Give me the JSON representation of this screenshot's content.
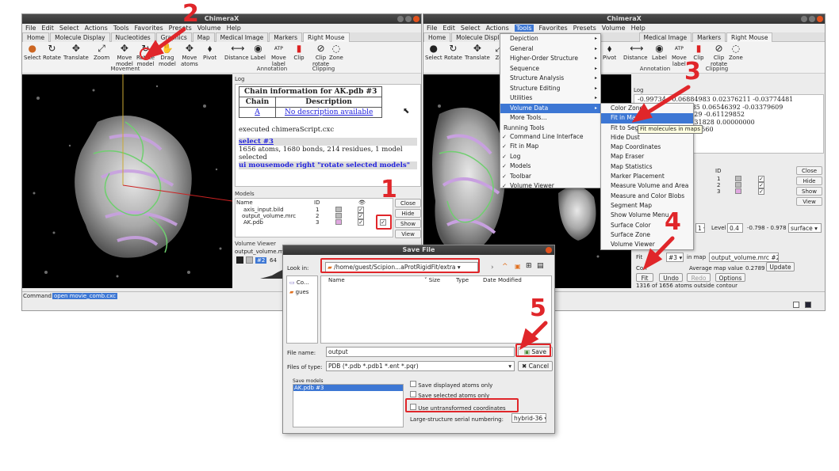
{
  "left_window": {
    "title": "ChimeraX",
    "menus": [
      "File",
      "Edit",
      "Select",
      "Actions",
      "Tools",
      "Favorites",
      "Presets",
      "Volume",
      "Help"
    ],
    "tabs": [
      "Home",
      "Molecule Display",
      "Nucleotides",
      "Graphics",
      "Map",
      "Medical Image",
      "Markers",
      "Right Mouse"
    ],
    "tools": [
      {
        "label": "Select",
        "icon": "●"
      },
      {
        "label": "Rotate",
        "icon": "↻"
      },
      {
        "label": "Translate",
        "icon": "✥"
      },
      {
        "label": "Zoom",
        "icon": "⤢"
      },
      {
        "label": "Move\nmodel",
        "icon": "✥"
      },
      {
        "label": "Rotate\nmodel",
        "icon": "↻"
      },
      {
        "label": "Drag\nmodel",
        "icon": "✋"
      },
      {
        "label": "Move\natoms",
        "icon": "✥"
      },
      {
        "label": "Pivot",
        "icon": "⬧"
      },
      {
        "label": "Distance",
        "icon": "⟷"
      },
      {
        "label": "Label",
        "icon": "◉"
      },
      {
        "label": "Move\nlabel",
        "icon": "ATP"
      },
      {
        "label": "Clip",
        "icon": "▮"
      },
      {
        "label": "Clip\nrotate",
        "icon": "⊘"
      },
      {
        "label": "Zone",
        "icon": "◌"
      }
    ],
    "groups": {
      "movement": "Movement",
      "annotation": "Annotation",
      "clipping": "Clipping"
    },
    "log": {
      "title": "Log",
      "chain_table": {
        "caption": "Chain information for AK.pdb #3",
        "headers": [
          "Chain",
          "Description"
        ],
        "rows": [
          [
            "A",
            "No description available"
          ]
        ]
      },
      "lines": [
        "executed chimeraScript.cxc",
        "select #3",
        "1656 atoms, 1680 bonds, 214 residues, 1 model selected",
        "ui mousemode right \"rotate selected models\""
      ]
    },
    "models": {
      "title": "Models",
      "headers": [
        "Name",
        "ID"
      ],
      "rows": [
        {
          "name": "axis_input.bild",
          "id": "1",
          "shown": "✓",
          "selected": ""
        },
        {
          "name": "output_volume.mrc",
          "id": "2",
          "shown": "✓",
          "selected": ""
        },
        {
          "name": "AK.pdb",
          "id": "3",
          "shown": "✓",
          "selected": "✓"
        }
      ],
      "buttons": [
        "Close",
        "Hide",
        "Show",
        "View"
      ]
    },
    "volume_viewer": {
      "title": "Volume Viewer",
      "name": "output_volume.m",
      "id": "#2",
      "value": "64"
    },
    "command": {
      "label": "Command:",
      "value": "open movie_comb.cxc"
    }
  },
  "right_window": {
    "title": "ChimeraX",
    "menus": [
      "File",
      "Edit",
      "Select",
      "Actions",
      "Tools",
      "Favorites",
      "Presets",
      "Volume",
      "Help"
    ],
    "tabs": [
      "Home",
      "Molecule Display",
      "Medical Image",
      "Markers",
      "Right Mouse"
    ],
    "tools_left": [
      "Select",
      "Rotate",
      "Translate",
      "Zo"
    ],
    "tools_right": [
      {
        "label": "Pivot",
        "icon": "⬧"
      },
      {
        "label": "Distance",
        "icon": "⟷"
      },
      {
        "label": "Label",
        "icon": "◉"
      },
      {
        "label": "Move\nlabel",
        "icon": "ATP"
      },
      {
        "label": "Clip",
        "icon": "▮"
      },
      {
        "label": "Clip\nrotate",
        "icon": "⊘"
      },
      {
        "label": "Zone",
        "icon": "◌"
      }
    ],
    "groups": {
      "annotation": "Annotation",
      "clipping": "Clipping"
    },
    "log_title": "Log",
    "log_lines": [
      "-0.99734   0.06884983 0.02376211 -0.03774481",
      "            0.03377735 0.06546392 -0.03379609",
      "             0.53260729 -0.61129852",
      "         9795 -0.03431828 0.00000000",
      "       ees) 119.48004560",
      "          0050298"
    ],
    "models": {
      "id_header": "ID",
      "ids": [
        "1",
        "2",
        "3"
      ],
      "buttons": [
        "Close",
        "Hide",
        "Show",
        "View"
      ]
    },
    "volume": {
      "level_label": "Level",
      "level": "0.4",
      "range": "-0.798 - 0.978",
      "style": "surface"
    },
    "fit": {
      "fit_label": "Fit",
      "fit_model": "#3",
      "in_map_label": "in map",
      "map": "output_volume.mrc #2",
      "correlation_label": "Corr",
      "avg_label": "Average map value",
      "avg": "0.2789",
      "update": "Update",
      "buttons": [
        "Fit",
        "Undo",
        "Redo",
        "Options"
      ],
      "status": "1316 of 1656 atoms outside contour"
    }
  },
  "tools_menu": {
    "items": [
      {
        "label": "Depiction",
        "sub": true
      },
      {
        "label": "General",
        "sub": true
      },
      {
        "label": "Higher-Order Structure",
        "sub": true
      },
      {
        "label": "Sequence",
        "sub": true
      },
      {
        "label": "Structure Analysis",
        "sub": true
      },
      {
        "label": "Structure Editing",
        "sub": true
      },
      {
        "label": "Utilities",
        "sub": true
      },
      {
        "label": "Volume Data",
        "sub": true,
        "selected": true
      },
      {
        "label": "More Tools...",
        "sub": false
      }
    ],
    "running_header": "Running Tools",
    "running": [
      "Command Line Interface",
      "Fit in Map",
      "Log",
      "Models",
      "Toolbar",
      "Volume Viewer"
    ]
  },
  "volume_submenu": {
    "items": [
      "Color Zone",
      "Fit in Map",
      "Fit to Segments",
      "Hide Dust",
      "Map Coordinates",
      "Map Eraser",
      "Map Statistics",
      "Marker Placement",
      "Measure Volume and Area",
      "Measure and Color Blobs",
      "Segment Map",
      "Show Volume Menu",
      "Surface Color",
      "Surface Zone",
      "Volume Viewer"
    ],
    "tooltip": "Fit molecules in maps"
  },
  "save_dialog": {
    "title": "Save File",
    "look_in_label": "Look in:",
    "look_in": "/home/guest/Scipion...aProtRigidFit/extra",
    "places": [
      "Co...",
      "gues"
    ],
    "columns": [
      "Name",
      "Size",
      "Type",
      "Date Modified"
    ],
    "file_name_label": "File name:",
    "file_name": "output",
    "save": "Save",
    "type_label": "Files of type:",
    "type": "PDB (*.pdb *.pdb1 *.ent *.pqr)",
    "cancel": "Cancel",
    "save_models_label": "Save models",
    "save_models": [
      "AK.pdb #3"
    ],
    "options": [
      "Save displayed atoms only",
      "Save selected atoms only",
      "Use untransformed coordinates"
    ],
    "serial_label": "Large-structure serial numbering:",
    "serial": "hybrid-36"
  },
  "annotations": [
    "1",
    "2",
    "3",
    "4",
    "5"
  ],
  "accent_color": "#e0262a",
  "select_color": "#3d77d4"
}
